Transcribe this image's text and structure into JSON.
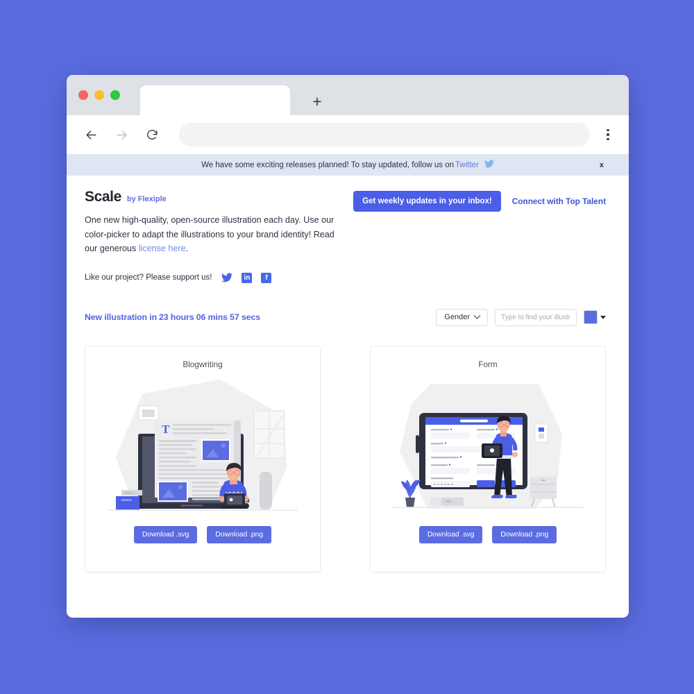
{
  "browser": {
    "tab_title": "",
    "url": "",
    "new_tab_label": "+",
    "back_icon": "arrow-left-icon",
    "forward_icon": "arrow-right-icon",
    "reload_icon": "reload-icon",
    "menu_icon": "kebab-menu-icon"
  },
  "banner": {
    "text": "We have some exciting releases planned! To stay updated, follow us on",
    "link_label": "Twitter",
    "bird_icon": "twitter-bird-icon",
    "close_label": "x"
  },
  "header": {
    "brand_name": "Scale",
    "brand_by": "by Flexiple",
    "tagline_part1": "One new high-quality, open-source illustration each day. Use our color-picker to adapt the illustrations to your brand identity! Read our generous ",
    "tagline_link": "license here",
    "tagline_part2": ".",
    "support_text": "Like our project? Please support us!",
    "social": [
      {
        "name": "twitter",
        "glyph": ""
      },
      {
        "name": "linkedin",
        "glyph": "in"
      },
      {
        "name": "facebook",
        "glyph": "f"
      }
    ],
    "cta_button": "Get weekly updates in your inbox!",
    "talent_link": "Connect with Top Talent"
  },
  "filters": {
    "countdown_label": "New illustration in",
    "countdown_timer": "23 hours 06 mins 57 secs",
    "gender_select": "Gender",
    "search_placeholder": "Type to find your illustrat",
    "search_value": "",
    "color_swatch": "#5b6ce0"
  },
  "cards": [
    {
      "title": "Blogwriting",
      "illustration": "blogwriting-illustration",
      "svg_label": "Download .svg",
      "png_label": "Download .png"
    },
    {
      "title": "Form",
      "illustration": "form-illustration",
      "svg_label": "Download .svg",
      "png_label": "Download .png"
    }
  ],
  "colors": {
    "page_background": "#5b6ce0",
    "accent": "#4a5ee8",
    "banner_background": "#dfe5f3",
    "link": "#6d8ae8"
  }
}
